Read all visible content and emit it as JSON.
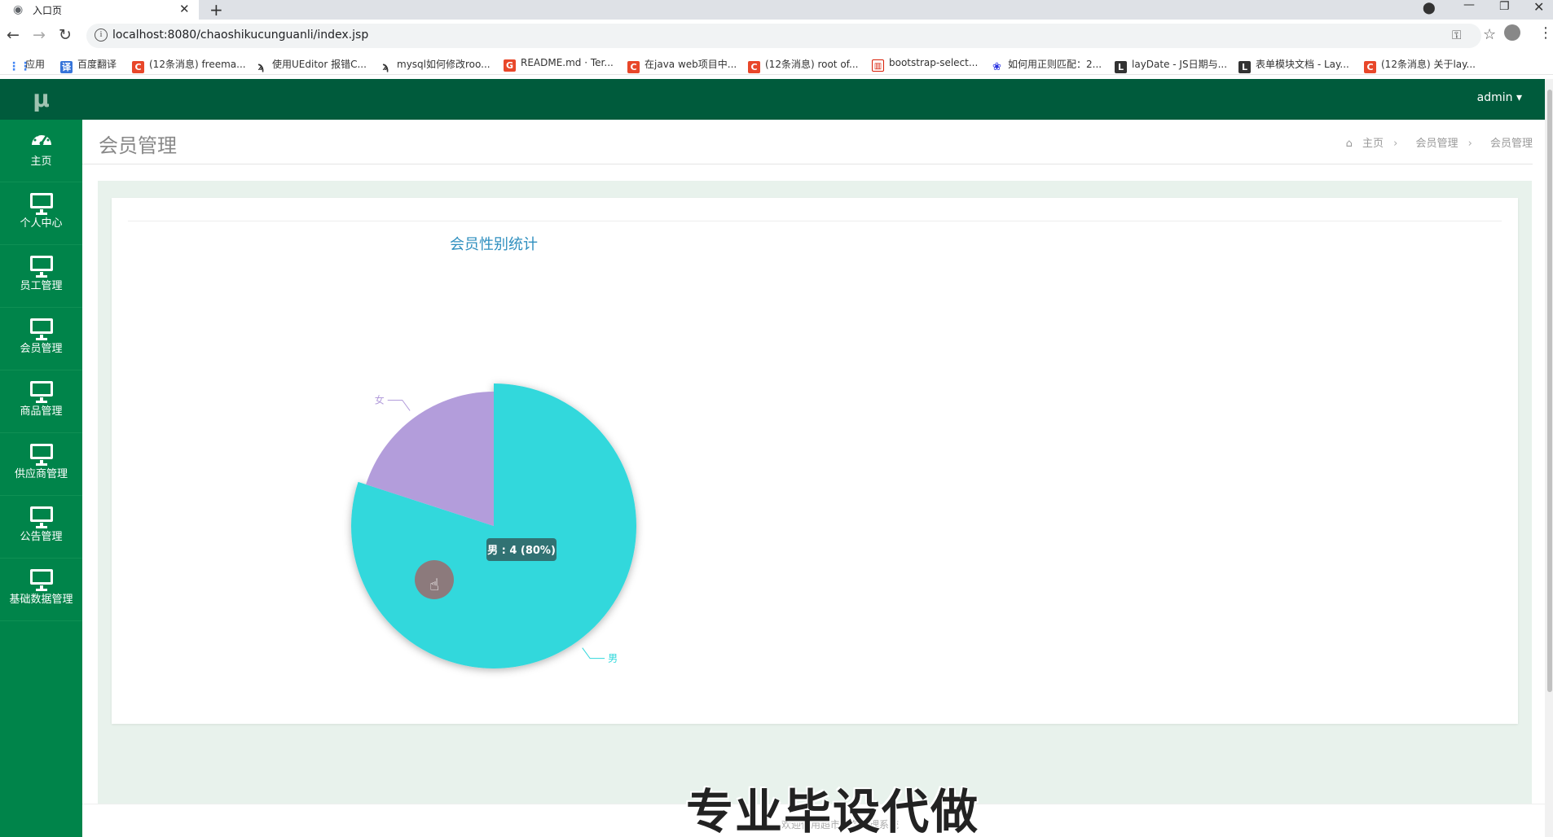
{
  "browser": {
    "tab_title": "入口页",
    "tab_close": "✕",
    "new_tab": "+",
    "url": "localhost:8080/chaoshikucunguanli/index.jsp",
    "bookmarks": [
      {
        "icon": "apps",
        "label": "应用"
      },
      {
        "icon": "translate",
        "label": "百度翻译"
      },
      {
        "icon": "csdn",
        "label": "(12条消息) freema..."
      },
      {
        "icon": "arrow",
        "label": "使用UEditor 报错C..."
      },
      {
        "icon": "arrow",
        "label": "mysql如何修改roo..."
      },
      {
        "icon": "gitee",
        "label": "README.md · Ter..."
      },
      {
        "icon": "csdn",
        "label": "在java web项目中..."
      },
      {
        "icon": "csdn",
        "label": "(12条消息) root of..."
      },
      {
        "icon": "book",
        "label": "bootstrap-select..."
      },
      {
        "icon": "baidu",
        "label": "如何用正则匹配：2..."
      },
      {
        "icon": "layui",
        "label": "layDate - JS日期与..."
      },
      {
        "icon": "layui",
        "label": "表单模块文档 - Lay..."
      },
      {
        "icon": "csdn",
        "label": "(12条消息) 关于lay..."
      }
    ]
  },
  "app": {
    "logo": "μ",
    "user": "admin ▾",
    "page_title": "会员管理",
    "breadcrumb": [
      "主页",
      "会员管理",
      "会员管理"
    ],
    "breadcrumb_sep": "›",
    "sidebar": [
      {
        "label": "主页",
        "icon": "dashboard-icon"
      },
      {
        "label": "个人中心",
        "icon": "monitor-icon"
      },
      {
        "label": "员工管理",
        "icon": "monitor-icon"
      },
      {
        "label": "会员管理",
        "icon": "monitor-icon"
      },
      {
        "label": "商品管理",
        "icon": "monitor-icon"
      },
      {
        "label": "供应商管理",
        "icon": "monitor-icon"
      },
      {
        "label": "公告管理",
        "icon": "monitor-icon"
      },
      {
        "label": "基础数据管理",
        "icon": "monitor-icon"
      }
    ],
    "footer": "欢迎使用超市库存管理系统",
    "watermark": "专业毕设代做"
  },
  "chart_data": {
    "type": "pie",
    "title": "会员性别统计",
    "categories": [
      "男",
      "女"
    ],
    "values": [
      4,
      1
    ],
    "colors": [
      "#31d8dc",
      "#b39ddb"
    ],
    "tooltip": "男 : 4 (80%)"
  }
}
